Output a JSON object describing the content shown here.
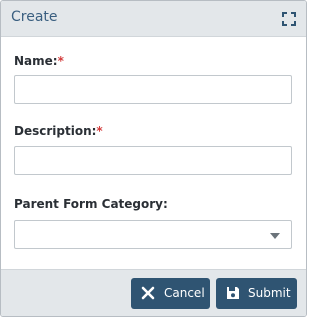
{
  "dialog": {
    "title": "Create",
    "maximize_icon": "expand-icon"
  },
  "form": {
    "name_label": "Name:",
    "description_label": "Description:",
    "parent_label": "Parent Form Category:",
    "required_marker": "*",
    "name_value": "",
    "description_value": "",
    "parent_selected": ""
  },
  "footer": {
    "cancel_label": "Cancel",
    "cancel_icon": "close-icon",
    "submit_label": "Submit",
    "submit_icon": "save-icon"
  },
  "colors": {
    "header_bg": "#e3e7ea",
    "title": "#3a5f80",
    "button_bg": "#2f5472",
    "required": "#d33b3b"
  }
}
